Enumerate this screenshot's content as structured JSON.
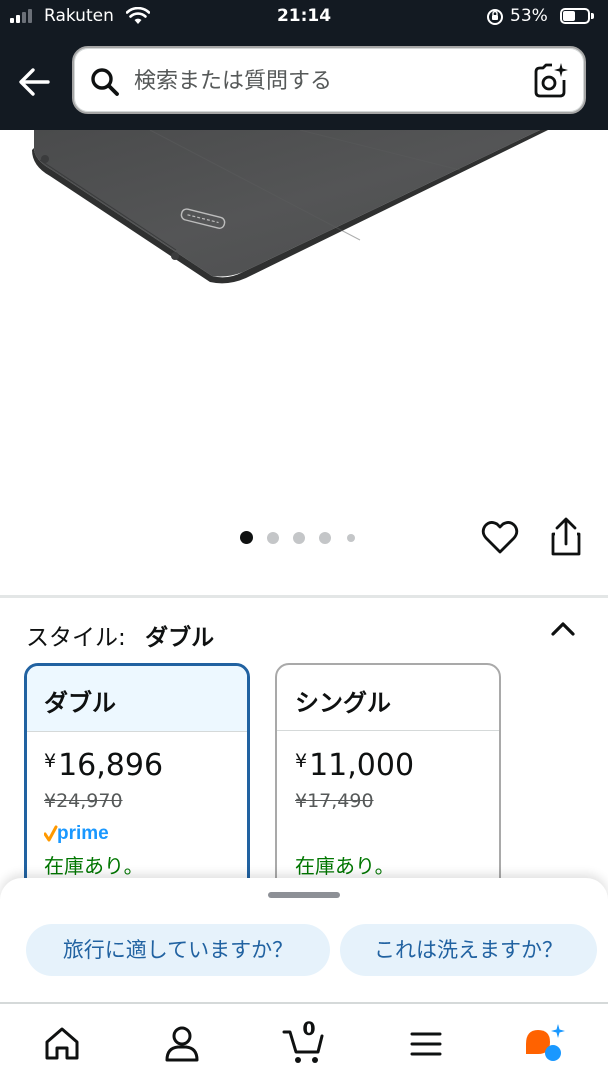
{
  "status_bar": {
    "carrier": "Rakuten",
    "time": "21:14",
    "battery_percent": "53%",
    "battery_level": 0.53
  },
  "header": {
    "search_placeholder": "検索または質問する",
    "icons": [
      "back-arrow-icon",
      "search-icon",
      "camera-lens-icon"
    ]
  },
  "gallery": {
    "image_count": 5,
    "active_index": 0,
    "icons": [
      "heart-icon",
      "share-icon"
    ]
  },
  "style_selector": {
    "label": "スタイル:",
    "selected_value": "ダブル",
    "options": [
      {
        "name": "ダブル",
        "price": "16,896",
        "currency": "¥",
        "list_price": "¥24,970",
        "prime": "prime",
        "stock": "在庫あり。",
        "selected": true
      },
      {
        "name": "シングル",
        "price": "11,000",
        "currency": "¥",
        "list_price": "¥17,490",
        "prime": "",
        "stock": "在庫あり。",
        "selected": false
      }
    ]
  },
  "suggestions": [
    "旅行に適していますか？",
    "これは洗えますか？"
  ],
  "bottom_nav": {
    "items": [
      "home-icon",
      "account-icon",
      "cart-icon",
      "menu-icon",
      "rufus-ai-icon"
    ],
    "cart_count": "0"
  },
  "colors": {
    "header_bg": "#131a22",
    "selected_border": "#2162a1",
    "stock_green": "#007600",
    "chip_bg": "#e6f2fb",
    "chip_text": "#2162a1",
    "prime_blue": "#1a98ff",
    "prime_check": "#ff9900",
    "rufus_orange": "#ff6200",
    "rufus_blue": "#1a98ff"
  }
}
